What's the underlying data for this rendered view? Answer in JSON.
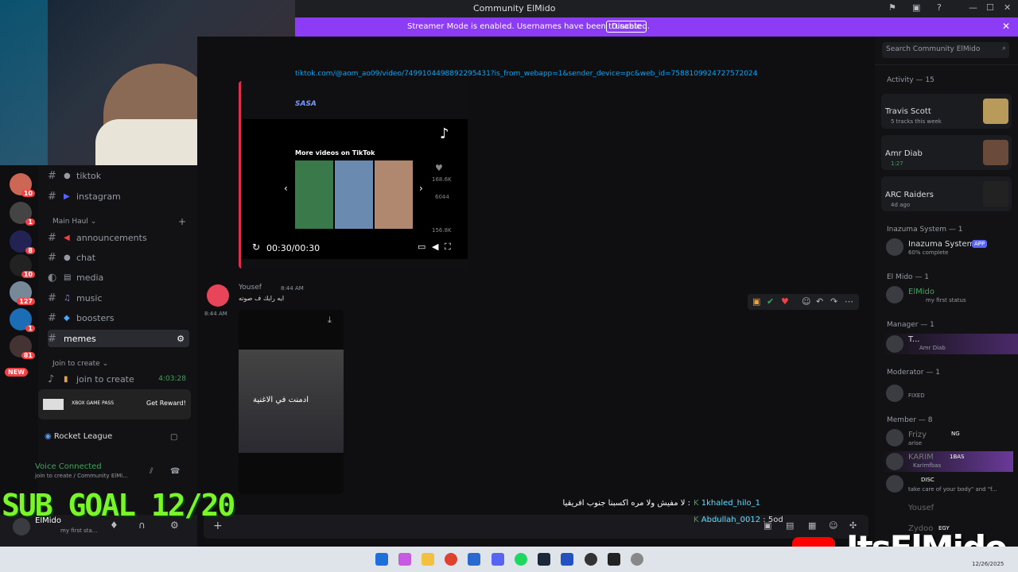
{
  "window": {
    "title": "Community ElMido"
  },
  "banner": {
    "text": "Streamer Mode is enabled. Usernames have been truncated.",
    "button": "Disable"
  },
  "header": {
    "search_placeholder": "Search Community ElMido"
  },
  "channels": [
    {
      "name": "tiktok"
    },
    {
      "name": "instagram"
    },
    {
      "category": "Main Haul"
    },
    {
      "name": "announcements"
    },
    {
      "name": "chat"
    },
    {
      "name": "media"
    },
    {
      "name": "music"
    },
    {
      "name": "boosters"
    },
    {
      "name": "memes"
    },
    {
      "category": "Join to create"
    },
    {
      "name": "join to create",
      "time": "4:03:28"
    }
  ],
  "server_badges": [
    "10",
    "1",
    "8",
    "10",
    "127",
    "1",
    "81",
    "NEW"
  ],
  "promo": {
    "brand": "XBOX GAME PASS",
    "button": "Get Reward!"
  },
  "activity_game": "Rocket League",
  "voice": {
    "status": "Voice Connected",
    "sub": "join to create / Community ElMi..."
  },
  "user": {
    "name": "ElMido",
    "status": "my first sta..."
  },
  "embed": {
    "link": "tiktok.com/@aom_ao09/video/7499104498892295431?is_from_webapp=1&sender_device=pc&web_id=7588109924727572024",
    "author": "SASA",
    "more": "More videos on TikTok",
    "stats": [
      "168.6K",
      "6044",
      "156.8K"
    ],
    "time": "00:30/00:30"
  },
  "message": {
    "author": "Yousef",
    "time": "8:44 AM",
    "text": "ايه رايك ف صوته",
    "side_time": "8:44 AM",
    "video_caption": "ادمنت في الاغنية"
  },
  "members": {
    "activity_header": "Activity — 15",
    "cards": [
      {
        "name": "Travis Scott",
        "sub": "5 tracks this week"
      },
      {
        "name": "Amr Diab",
        "sub": "1:27"
      },
      {
        "name": "ARC Raiders",
        "sub": "4d ago"
      }
    ],
    "groups": [
      {
        "header": "Inazuma System — 1",
        "name": "Inazuma System",
        "tag": "APP",
        "sub": "60% complete"
      },
      {
        "header": "El Mido — 1",
        "name": "ElMido",
        "sub": "my first status"
      },
      {
        "header": "Manager — 1",
        "name": "T...",
        "sub": "Amr Diab"
      },
      {
        "header": "Moderator — 1",
        "name": "",
        "sub": "FIXED"
      },
      {
        "header": "Member — 8",
        "name": "Frizy",
        "tag": "NG",
        "sub": "arise"
      }
    ],
    "extra": [
      {
        "name": "KARIM",
        "tag": "1BAS",
        "sub": "Karimfbas"
      },
      {
        "name": "",
        "tag": "DISC",
        "sub": "take care of your body\" and \"f..."
      },
      {
        "name": "Yousef",
        "sub": ""
      },
      {
        "name": "Zydoo",
        "tag": "EGY",
        "sub": ""
      }
    ]
  },
  "chat_overlay": [
    {
      "user": "1khaled_hilo_1",
      "text": "لا مفيش ولا مره اكسبنا جنوب افريقيا :"
    },
    {
      "user": "Abdullah_0012",
      "text": "5od"
    }
  ],
  "overlay": {
    "sub_goal": "SUB GOAL 12/20",
    "brand": "ItsElMido"
  },
  "taskbar": {
    "date": "12/26/2025"
  }
}
